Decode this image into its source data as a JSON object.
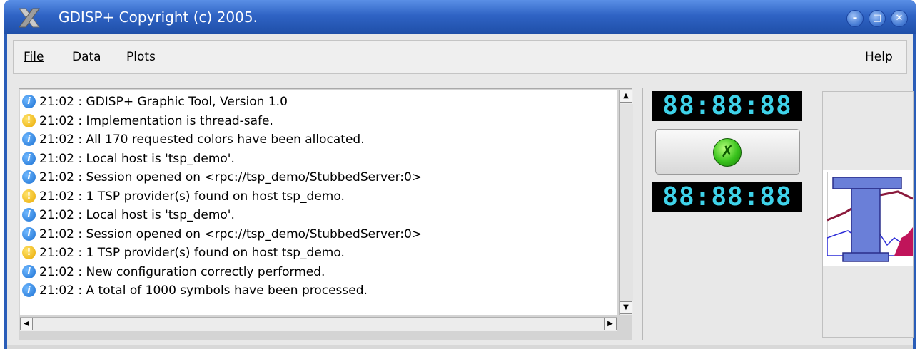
{
  "window": {
    "title": "GDISP+ Copyright (c) 2005."
  },
  "menubar": {
    "file": "File",
    "data": "Data",
    "plots": "Plots",
    "help": "Help"
  },
  "log": [
    {
      "icon": "info-icon",
      "text": "21:02 : GDISP+ Graphic Tool, Version 1.0"
    },
    {
      "icon": "warning-icon",
      "text": "21:02 : Implementation is thread-safe."
    },
    {
      "icon": "info-icon",
      "text": "21:02 : All 170 requested colors have been allocated."
    },
    {
      "icon": "info-icon",
      "text": "21:02 : Local host is 'tsp_demo'."
    },
    {
      "icon": "info-icon",
      "text": "21:02 : Session opened on <rpc://tsp_demo/StubbedServer:0>"
    },
    {
      "icon": "warning-icon",
      "text": "21:02 : 1 TSP provider(s) found on host tsp_demo."
    },
    {
      "icon": "info-icon",
      "text": "21:02 : Local host is 'tsp_demo'."
    },
    {
      "icon": "info-icon",
      "text": "21:02 : Session opened on <rpc://tsp_demo/StubbedServer:0>"
    },
    {
      "icon": "warning-icon",
      "text": "21:02 : 1 TSP provider(s) found on host tsp_demo."
    },
    {
      "icon": "info-icon",
      "text": "21:02 : New configuration correctly performed."
    },
    {
      "icon": "info-icon",
      "text": "21:02 : A total of 1000 symbols have been processed."
    }
  ],
  "timers": {
    "top": "88:88:88",
    "bottom": "88:88:88"
  },
  "colors": {
    "info": "#1a6fd1",
    "warning": "#e9a800",
    "lcd": "#3fd3ea",
    "go": "#38c21c"
  }
}
